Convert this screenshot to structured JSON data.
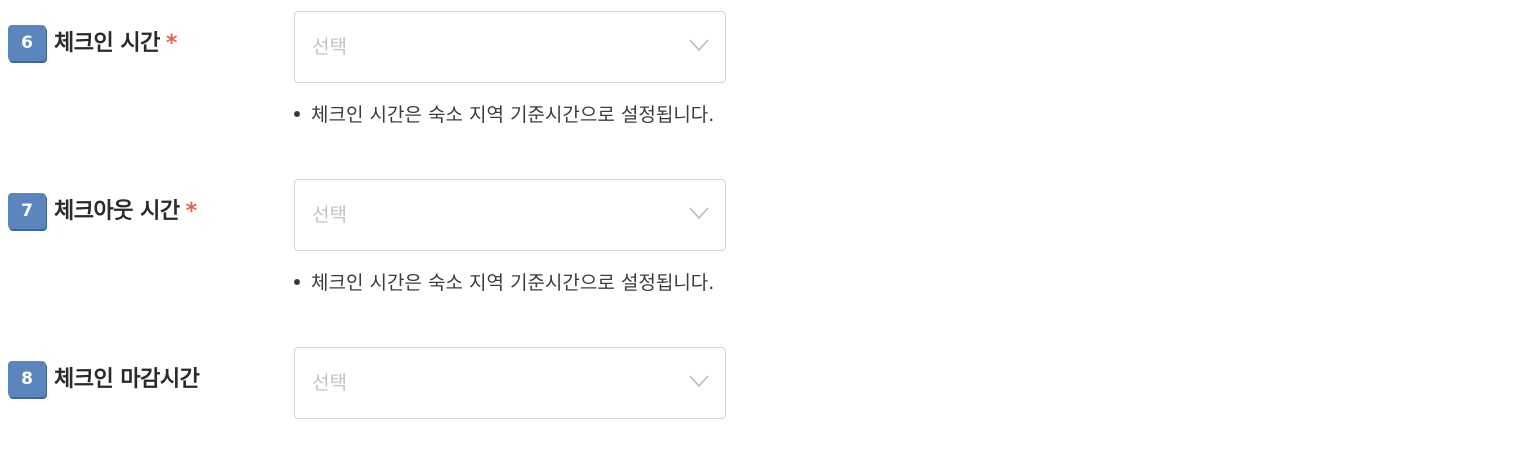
{
  "fields": [
    {
      "number": "6",
      "label": "체크인 시간",
      "required_mark": "*",
      "select": {
        "placeholder": "선택",
        "icon": "chevron-down-icon"
      },
      "help_text": "체크인 시간은 숙소 지역 기준시간으로 설정됩니다."
    },
    {
      "number": "7",
      "label": "체크아웃 시간",
      "required_mark": "*",
      "select": {
        "placeholder": "선택",
        "icon": "chevron-down-icon"
      },
      "help_text": "체크인 시간은 숙소 지역 기준시간으로 설정됩니다."
    },
    {
      "number": "8",
      "label": "체크인 마감시간",
      "select": {
        "placeholder": "선택",
        "icon": "chevron-down-icon"
      }
    }
  ],
  "colors": {
    "badge": "#5b86bd",
    "required": "#e8604c",
    "placeholder": "#c4c4c4",
    "border": "#d6d6d6"
  }
}
